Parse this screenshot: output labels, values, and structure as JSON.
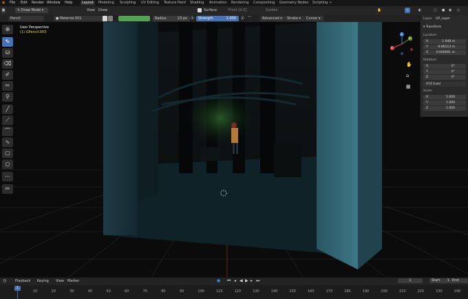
{
  "menubar": {
    "menus": [
      "File",
      "Edit",
      "Render",
      "Window",
      "Help"
    ],
    "workspaces": [
      "Layout",
      "Modeling",
      "Sculpting",
      "UV Editing",
      "Texture Paint",
      "Shading",
      "Animation",
      "Rendering",
      "Compositing",
      "Geometry Nodes",
      "Scripting"
    ],
    "active_workspace": "Layout"
  },
  "header": {
    "mode": "Draw Mode",
    "view": "View",
    "draw": "Draw",
    "surface": "Surface",
    "front": "Front (X-Z)",
    "guides": "Guides"
  },
  "toolsettings": {
    "brush": "Pencil",
    "material": "Material.001",
    "radius_label": "Radius",
    "radius_value": "23 px",
    "strength_label": "Strength",
    "strength_value": "1.000",
    "advanced": "Advanced",
    "stroke": "Stroke",
    "cursor": "Cursor"
  },
  "viewport": {
    "perspective": "User Perspective",
    "object": "(1) GPencil.003"
  },
  "gizmo": {
    "x": "X",
    "y": "Y",
    "z": "Z"
  },
  "npanel": {
    "layer_label": "Layer",
    "layer_value": "GP_Layer",
    "section": "Transform",
    "location_label": "Location:",
    "location": [
      {
        "axis": "X",
        "value": "1.648 m"
      },
      {
        "axis": "Y",
        "value": "-0.86113 m"
      },
      {
        "axis": "Z",
        "value": "0.000001 m"
      }
    ],
    "rotation_label": "Rotation:",
    "rotation": [
      {
        "axis": "X",
        "value": "0°"
      },
      {
        "axis": "Y",
        "value": "0°"
      },
      {
        "axis": "Z",
        "value": "0°"
      }
    ],
    "rotation_mode": "XYZ Euler",
    "scale_label": "Scale:",
    "scale": [
      {
        "axis": "X",
        "value": "1.000"
      },
      {
        "axis": "Y",
        "value": "1.000"
      },
      {
        "axis": "Z",
        "value": "1.000"
      }
    ]
  },
  "timeline": {
    "playback": "Playback",
    "keying": "Keying",
    "view": "View",
    "marker": "Marker",
    "current_frame": "1",
    "start_label": "Start",
    "start_value": "1",
    "end_label": "End",
    "end_value": "250",
    "ticks": [
      "1",
      "10",
      "20",
      "30",
      "40",
      "50",
      "60",
      "70",
      "80",
      "90",
      "100",
      "110",
      "120",
      "130",
      "140",
      "150",
      "160",
      "170",
      "180",
      "190",
      "200",
      "210",
      "220",
      "230",
      "240",
      "250"
    ]
  },
  "colors": {
    "accent": "#4772b3",
    "axis_x": "#e0433f",
    "axis_y": "#6aa82a",
    "axis_z": "#3d7fd4",
    "viewport_text": "#ffffff",
    "object_text": "#e6d84a"
  }
}
